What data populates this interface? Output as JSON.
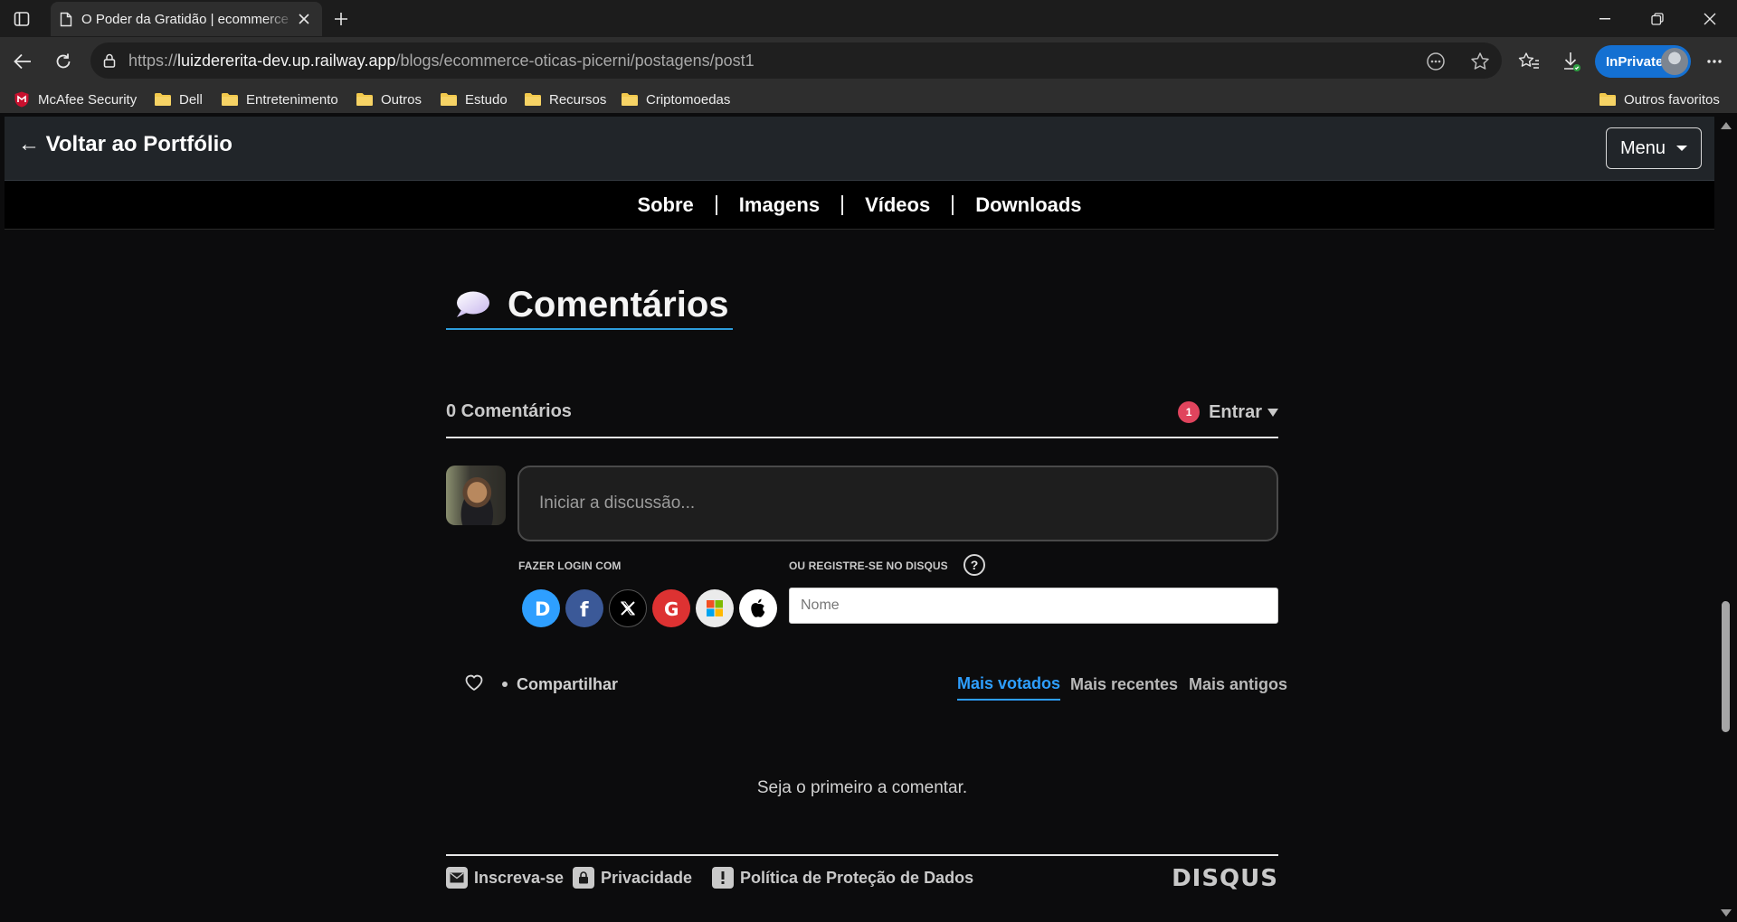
{
  "browser": {
    "tab_title": "O Poder da Gratidão | ecommerce",
    "url_prefix": "https://",
    "url_host": "luizdererita-dev.up.railway.app",
    "url_path": "/blogs/ecommerce-oticas-picerni/postagens/post1",
    "inprivate_label": "InPrivate",
    "bookmarks": [
      {
        "label": "McAfee Security",
        "icon": "mcafee-icon"
      },
      {
        "label": "Dell",
        "icon": "folder-icon"
      },
      {
        "label": "Entretenimento",
        "icon": "folder-icon"
      },
      {
        "label": "Outros",
        "icon": "folder-icon"
      },
      {
        "label": "Estudo",
        "icon": "folder-icon"
      },
      {
        "label": "Recursos",
        "icon": "folder-icon"
      },
      {
        "label": "Criptomoedas",
        "icon": "folder-icon"
      }
    ],
    "other_favorites": "Outros favoritos"
  },
  "site": {
    "back_link": "← Voltar ao Portfólio",
    "menu_label": "Menu",
    "nav": [
      "Sobre",
      "Imagens",
      "Vídeos",
      "Downloads"
    ]
  },
  "comments": {
    "title": "Comentários",
    "title_icon": "speech-balloon-icon",
    "count_label": "0 Comentários",
    "notification_count": "1",
    "login_label": "Entrar",
    "input_placeholder": "Iniciar a discussão...",
    "login_with_label": "FAZER LOGIN COM",
    "register_label": "OU REGISTRE-SE NO DISQUS",
    "help_symbol": "?",
    "social_providers": [
      "disqus",
      "facebook",
      "x",
      "google",
      "microsoft",
      "apple"
    ],
    "name_placeholder": "Nome",
    "share_label": "Compartilhar",
    "sort_tabs": [
      "Mais votados",
      "Mais recentes",
      "Mais antigos"
    ],
    "active_sort": "Mais votados",
    "empty_message": "Seja o primeiro a comentar.",
    "footer": {
      "subscribe": "Inscreva-se",
      "privacy": "Privacidade",
      "data_policy": "Política de Proteção de Dados",
      "brand": "DISQUS"
    }
  },
  "colors": {
    "accent_blue": "#2e9fff",
    "inprivate_blue": "#1470d2",
    "notification_red": "#e0445d",
    "header_bg": "#212529",
    "page_bg": "#0c0c0d"
  }
}
